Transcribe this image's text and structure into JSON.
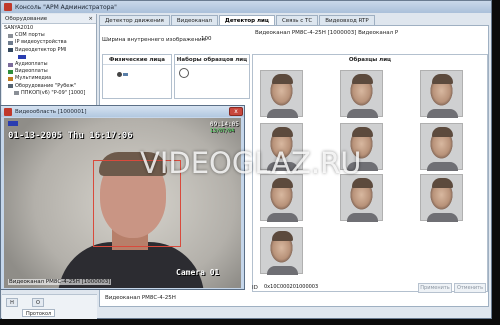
{
  "window": {
    "title": "Консоль \"АРМ Администратора\""
  },
  "tree": {
    "header": "Оборудование",
    "items": [
      "SANYA2010",
      "COM порты",
      "IP видеоустройства",
      "Видеодетектор PMI",
      "",
      "Аудиоплаты",
      "Видеоплаты",
      "Мультимедиа",
      "Оборудование \"Рубеж\"",
      "ППКОП(v6) \"P-09\" [1000]"
    ]
  },
  "tabs": [
    "Детектор движения",
    "Видеоканал",
    "Детектор лиц",
    "Связь с ТС",
    "Видеовход RTP"
  ],
  "active_tab": 2,
  "top_channel_label": "Видеоканал PM8C-4-25H [1000003] Видеоканал P",
  "width_setting": {
    "label": "Ширина внутреннего изображения:",
    "value": "100"
  },
  "columns": {
    "persons": "Физические лица",
    "samples": "Наборы образцов лиц",
    "faces": "Образцы лиц"
  },
  "bottom": {
    "id_label": "ID",
    "id_value": "0x10C000201000003",
    "apply": "Применить",
    "cancel": "Отменить",
    "channel_label": "Видеоканал PM8C-4-25H"
  },
  "bottom_left": {
    "buttons": [
      "Н",
      "О"
    ],
    "tab": "Протокол"
  },
  "video": {
    "title": "Видеообласть [1000001]",
    "close": "x",
    "date": "01-13-2005 Thu 16:17:06",
    "top_right_1": "09:14:05",
    "top_right_2": "13/07/04",
    "camera": "Camera 01",
    "caption": "Видеоканал PM8C-4-25H [1000003]"
  },
  "watermark": "VIDEOGLAZ.RU",
  "colors": {
    "accent": "#d94a3c",
    "window_bg": "#dfe6ee"
  }
}
